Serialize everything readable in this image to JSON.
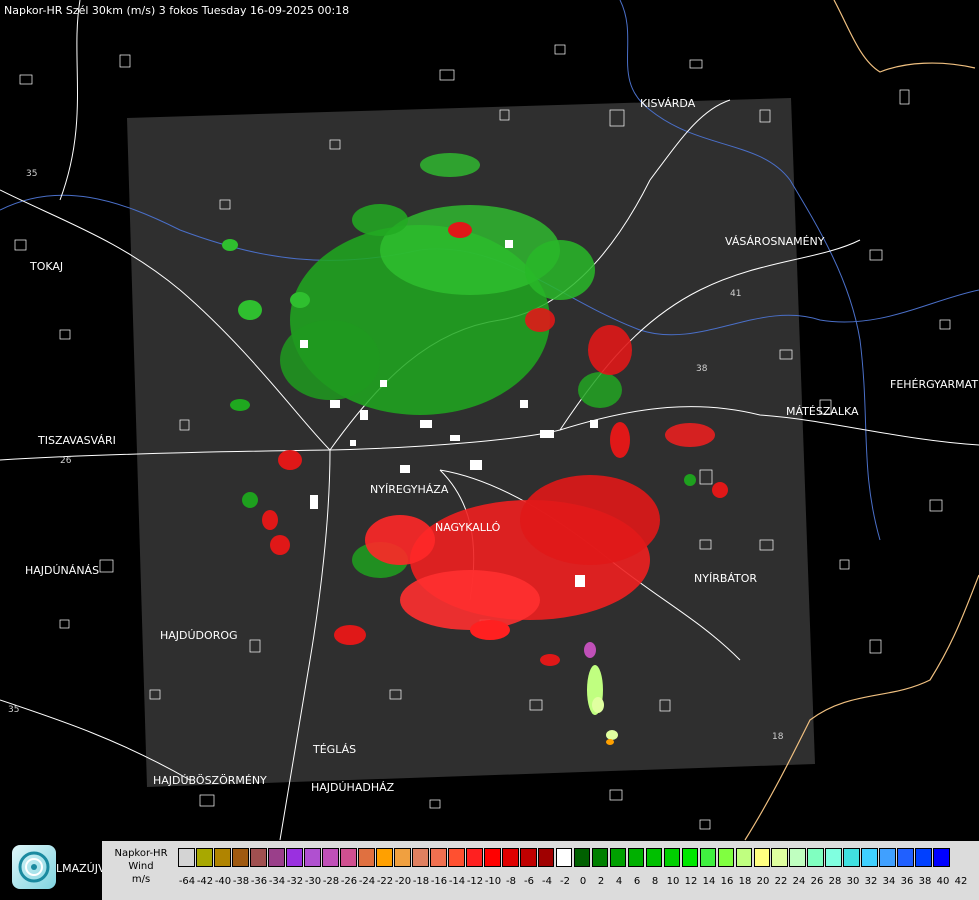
{
  "title": "Napkor-HR Szél 30km (m/s) 3 fokos Tuesday 16-09-2025 00:18",
  "towns": [
    {
      "id": "kisvarda",
      "name": "KISVÁRDA"
    },
    {
      "id": "vasarosnameny",
      "name": "VÁSÁROSNAMÉNY"
    },
    {
      "id": "tokaj",
      "name": "TOKAJ"
    },
    {
      "id": "fehergyarmat",
      "name": "FEHÉRGYARMAT"
    },
    {
      "id": "mateszalka",
      "name": "MÁTÉSZALKA"
    },
    {
      "id": "tiszavasvari",
      "name": "TISZAVASVÁRI"
    },
    {
      "id": "nyiregyhaza",
      "name": "NYÍREGYHÁZA"
    },
    {
      "id": "nagykallo",
      "name": "NAGYKALLÓ"
    },
    {
      "id": "hajdunanas",
      "name": "HAJDÚNÁNÁS"
    },
    {
      "id": "nyirbator",
      "name": "NYÍRBÁTOR"
    },
    {
      "id": "hajdudorog",
      "name": "HAJDÚDOROG"
    },
    {
      "id": "teglas",
      "name": "TÉGLÁS"
    },
    {
      "id": "hajduboszormeny",
      "name": "HAJDÚBÖSZÖRMÉNY"
    },
    {
      "id": "hajduhadhaz",
      "name": "HAJDÚHADHÁZ"
    }
  ],
  "road_labels": [
    "35",
    "26",
    "41",
    "38",
    "35",
    "18"
  ],
  "legend": {
    "title_line1": "Napkor-HR",
    "title_line2": "Wind",
    "unit": "m/s",
    "tick_labels": [
      "-64",
      "-42",
      "-40",
      "-38",
      "-36",
      "-34",
      "-32",
      "-30",
      "-28",
      "-26",
      "-24",
      "-22",
      "-20",
      "-18",
      "-16",
      "-14",
      "-12",
      "-10",
      "-8",
      "-6",
      "-4",
      "-2",
      "0",
      "2",
      "4",
      "6",
      "8",
      "10",
      "12",
      "14",
      "16",
      "18",
      "20",
      "22",
      "24",
      "26",
      "28",
      "30",
      "32",
      "34",
      "36",
      "38",
      "40",
      "42"
    ],
    "colors": [
      "#d4d4d4",
      "#a8a800",
      "#b08400",
      "#a05a10",
      "#a05050",
      "#9a3f8a",
      "#9a30e0",
      "#b050d0",
      "#c050b8",
      "#d05090",
      "#e07040",
      "#ffa000",
      "#f0a040",
      "#e08060",
      "#f07050",
      "#ff5030",
      "#ff2020",
      "#ff0000",
      "#e00000",
      "#c00000",
      "#a00000",
      "#ffffff",
      "#006000",
      "#008000",
      "#00a000",
      "#00b000",
      "#00c000",
      "#00d000",
      "#00e800",
      "#40f040",
      "#80ff40",
      "#c0ff80",
      "#ffff80",
      "#e0ffa0",
      "#c0ffc0",
      "#80ffc0",
      "#80ffe0",
      "#40e0e0",
      "#40d0ff",
      "#40a0ff",
      "#2060ff",
      "#0040ff",
      "#0000ff"
    ]
  },
  "logo_text": "LMAZÚJVÁR"
}
